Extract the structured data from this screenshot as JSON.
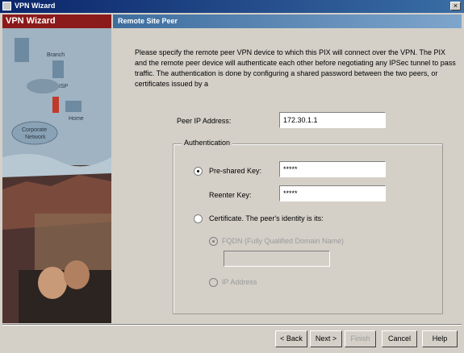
{
  "window": {
    "title": "VPN Wizard",
    "close_glyph": "×"
  },
  "sidebar": {
    "header": "VPN Wizard",
    "image_labels": {
      "branch": "Branch",
      "isp": "ISP",
      "home": "Home",
      "corporate_1": "Corporate",
      "corporate_2": "Network"
    }
  },
  "page": {
    "title": "Remote Site Peer",
    "description": "Please specify the remote peer VPN device to which this PIX will connect over the VPN. The PIX and the remote peer device will authenticate each other before negotiating any IPSec tunnel to pass traffic. The authentication is done by configuring a shared password between the two peers, or certificates issued by a"
  },
  "peer_ip": {
    "label": "Peer IP Address:",
    "value": "172.30.1.1"
  },
  "authentication": {
    "legend": "Authentication",
    "preshared": {
      "label": "Pre-shared Key:",
      "value": "*****",
      "selected": true
    },
    "reenter": {
      "label": "Reenter Key:",
      "value": "*****"
    },
    "certificate": {
      "label": "Certificate. The peer's identity is its:",
      "selected": false
    },
    "fqdn": {
      "label": "FQDN (Fully Qualified Domain Name)",
      "value": "",
      "selected": true,
      "enabled": false
    },
    "ip_address": {
      "label": "IP Address",
      "selected": false,
      "enabled": false
    }
  },
  "buttons": {
    "back": "< Back",
    "next": "Next >",
    "finish": "Finish",
    "cancel": "Cancel",
    "help": "Help"
  }
}
